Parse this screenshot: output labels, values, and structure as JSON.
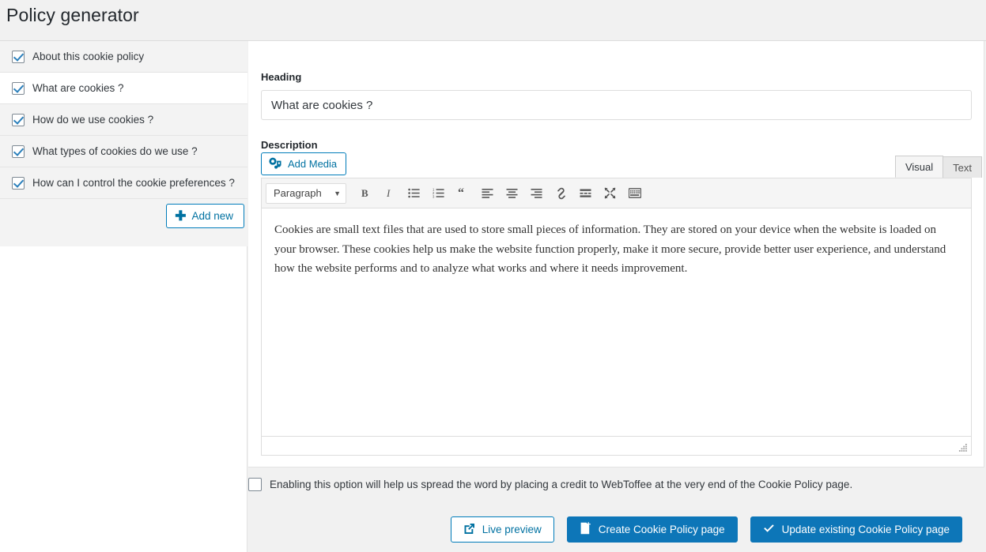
{
  "page": {
    "title": "Policy generator"
  },
  "sidebar": {
    "topics": [
      {
        "label": "About this cookie policy",
        "checked": true,
        "active": false
      },
      {
        "label": "What are cookies ?",
        "checked": true,
        "active": true
      },
      {
        "label": "How do we use cookies ?",
        "checked": true,
        "active": false
      },
      {
        "label": "What types of cookies do we use ?",
        "checked": true,
        "active": false
      },
      {
        "label": "How can I control the cookie preferences ?",
        "checked": true,
        "active": false
      }
    ],
    "add_new_label": "Add new",
    "add_new_icon": "plus-icon"
  },
  "form": {
    "heading_label": "Heading",
    "heading_value": "What are cookies ?",
    "description_label": "Description",
    "add_media_label": "Add Media",
    "add_media_icon": "media-icon"
  },
  "editor": {
    "tabs": [
      {
        "label": "Visual",
        "active": true
      },
      {
        "label": "Text",
        "active": false
      }
    ],
    "format_select": "Paragraph",
    "toolbar_buttons": [
      {
        "name": "bold-icon",
        "title": "Bold"
      },
      {
        "name": "italic-icon",
        "title": "Italic"
      },
      {
        "name": "bulleted-list-icon",
        "title": "Bulleted list"
      },
      {
        "name": "numbered-list-icon",
        "title": "Numbered list"
      },
      {
        "name": "blockquote-icon",
        "title": "Blockquote"
      },
      {
        "name": "align-left-icon",
        "title": "Align left"
      },
      {
        "name": "align-center-icon",
        "title": "Align center"
      },
      {
        "name": "align-right-icon",
        "title": "Align right"
      },
      {
        "name": "link-icon",
        "title": "Insert link"
      },
      {
        "name": "read-more-icon",
        "title": "Insert Read More tag"
      },
      {
        "name": "distraction-free-icon",
        "title": "Distraction-free writing mode"
      },
      {
        "name": "toolbar-toggle-icon",
        "title": "Toolbar Toggle"
      }
    ],
    "body_text": "Cookies are small text files that are used to store small pieces of information. They are stored on your device when the website is loaded on your browser. These cookies help us make the website function properly, make it more secure, provide better user experience, and understand how the website performs and to analyze what works and where it needs improvement.",
    "resize_handle_icon": "resize-grip-icon"
  },
  "credit": {
    "checked": false,
    "text": "Enabling this option will help us spread the word by placing a credit to WebToffee at the very end of the Cookie Policy page."
  },
  "footer": {
    "live_preview_label": "Live preview",
    "live_preview_icon": "external-link-icon",
    "create_page_label": "Create Cookie Policy page",
    "create_page_icon": "new-page-icon",
    "update_page_label": "Update existing Cookie Policy page",
    "update_page_icon": "check-icon"
  },
  "colors": {
    "accent_blue": "#0d76b8",
    "link_blue": "#0071a1",
    "border_blue": "#007cba",
    "row_gray": "#f3f3f3",
    "page_bg": "#f1f1f1"
  }
}
